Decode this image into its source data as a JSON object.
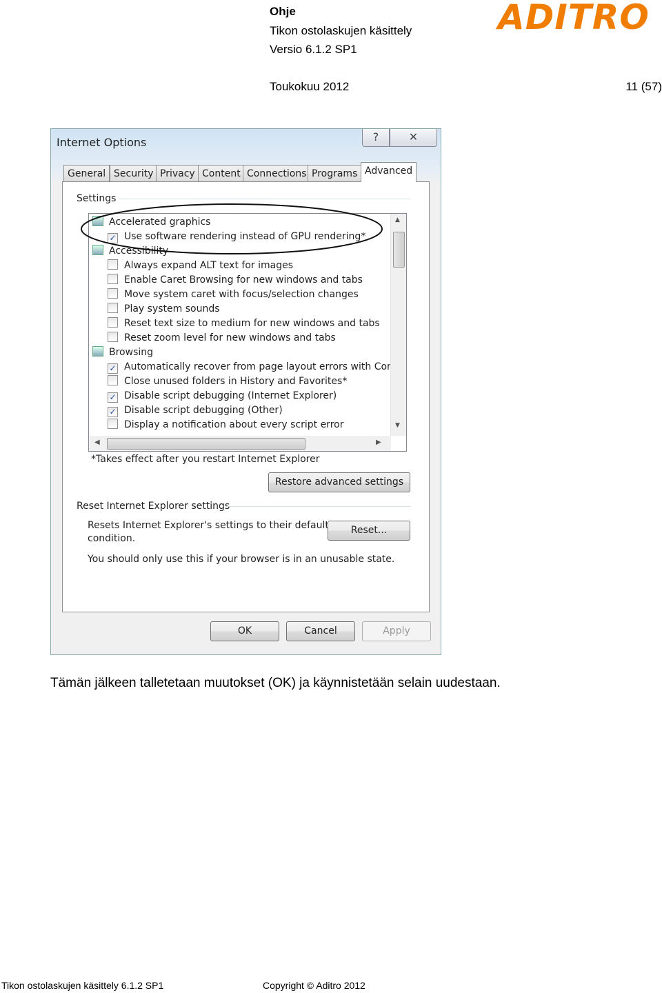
{
  "header": {
    "doc_type": "Ohje",
    "doc_title": "Tikon ostolaskujen käsittely",
    "version": "Versio 6.1.2 SP1",
    "date": "Toukokuu 2012",
    "page": "11 (57)",
    "logo": "ADITRO",
    "brand_color": "#f07d00"
  },
  "dialog": {
    "title": "Internet Options",
    "help_icon": "question-icon",
    "close_icon": "close-icon",
    "tabs": [
      {
        "label": "General"
      },
      {
        "label": "Security"
      },
      {
        "label": "Privacy"
      },
      {
        "label": "Content"
      },
      {
        "label": "Connections"
      },
      {
        "label": "Programs"
      },
      {
        "label": "Advanced",
        "active": true
      }
    ],
    "settings_label": "Settings",
    "settings": [
      {
        "type": "category",
        "label": "Accelerated graphics"
      },
      {
        "type": "checkbox",
        "label": "Use software rendering instead of GPU rendering*",
        "checked": true
      },
      {
        "type": "category",
        "label": "Accessibility"
      },
      {
        "type": "checkbox",
        "label": "Always expand ALT text for images",
        "checked": false
      },
      {
        "type": "checkbox",
        "label": "Enable Caret Browsing for new windows and tabs",
        "checked": false
      },
      {
        "type": "checkbox",
        "label": "Move system caret with focus/selection changes",
        "checked": false
      },
      {
        "type": "checkbox",
        "label": "Play system sounds",
        "checked": false
      },
      {
        "type": "checkbox",
        "label": "Reset text size to medium for new windows and tabs",
        "checked": false
      },
      {
        "type": "checkbox",
        "label": "Reset zoom level for new windows and tabs",
        "checked": false
      },
      {
        "type": "category",
        "label": "Browsing"
      },
      {
        "type": "checkbox",
        "label": "Automatically recover from page layout errors with Comp",
        "checked": true
      },
      {
        "type": "checkbox",
        "label": "Close unused folders in History and Favorites*",
        "checked": false
      },
      {
        "type": "checkbox",
        "label": "Disable script debugging (Internet Explorer)",
        "checked": true
      },
      {
        "type": "checkbox",
        "label": "Disable script debugging (Other)",
        "checked": true
      },
      {
        "type": "checkbox",
        "label": "Display a notification about every script error",
        "checked": false
      }
    ],
    "restart_note": "*Takes effect after you restart Internet Explorer",
    "restore_button": "Restore advanced settings",
    "reset_group_label": "Reset Internet Explorer settings",
    "reset_desc_1": "Resets Internet Explorer's settings to their default",
    "reset_desc_2": "condition.",
    "reset_button": "Reset...",
    "reset_warning": "You should only use this if your browser is in an unusable state.",
    "ok_button": "OK",
    "cancel_button": "Cancel",
    "apply_button": "Apply"
  },
  "body_text": "Tämän jälkeen talletetaan muutokset (OK) ja käynnistetään selain uudestaan.",
  "footer": {
    "left": "Tikon ostolaskujen käsittely 6.1.2 SP1",
    "center": "Copyright © Aditro 2012"
  }
}
